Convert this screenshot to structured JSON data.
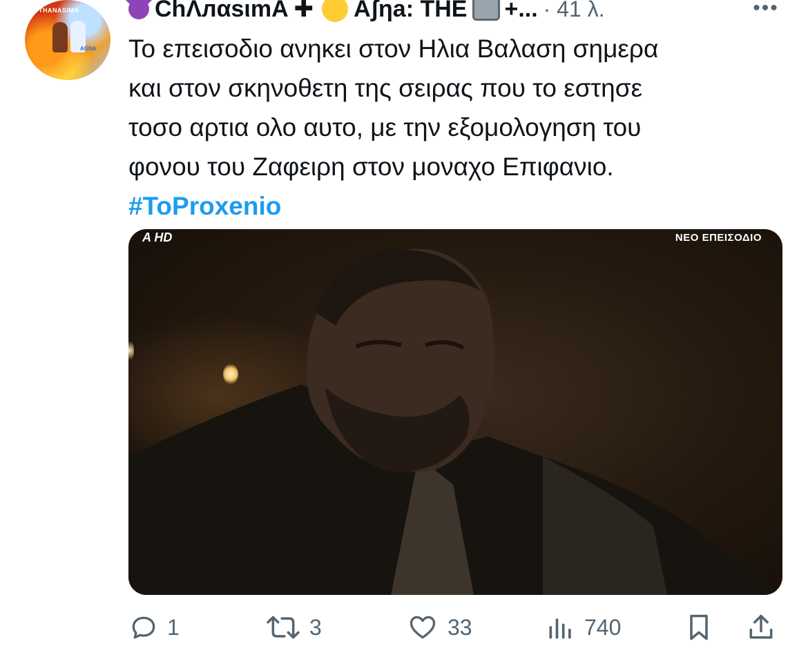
{
  "author": {
    "display_name": "ChΛлαsιmA",
    "display_name_2": "Aʃηa: THE",
    "plus": "+...",
    "time": "· 41 λ."
  },
  "tweet": {
    "lines": [
      "Το επεισοδιο ανηκει στον Ηλια Βαλαση σημερα",
      "και στον σκηνοθετη της σειρας που το εστησε",
      "τοσο αρτια ολο αυτο, με την εξομολογηση του",
      "φονου του Ζαφειρη στον μοναχο Επιφανιο."
    ],
    "hashtag": "#ToProxenio"
  },
  "media": {
    "channel_logo": "A HD",
    "badge": "ΝΕΟ ΕΠΕΙΣΟΔΙΟ"
  },
  "actions": {
    "replies": "1",
    "retweets": "3",
    "likes": "33",
    "views": "740"
  },
  "colors": {
    "link": "#1d9bf0",
    "muted": "#536471",
    "text": "#0f1419"
  },
  "icons": [
    "more-icon",
    "reply-icon",
    "retweet-icon",
    "like-icon",
    "views-icon",
    "bookmark-icon",
    "share-icon"
  ]
}
